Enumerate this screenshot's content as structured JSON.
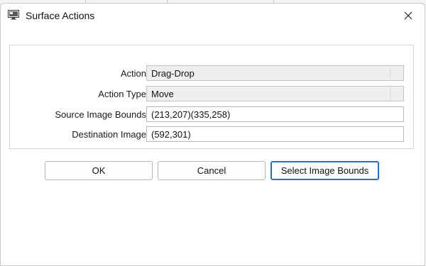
{
  "window": {
    "title": "Surface Actions",
    "icon": "monitor-app-icon",
    "close_icon": "close-icon"
  },
  "form": {
    "action": {
      "label": "Action",
      "value": "Drag-Drop"
    },
    "action_type": {
      "label": "Action Type",
      "value": "Move"
    },
    "source_bounds": {
      "label": "Source Image Bounds",
      "value": "(213,207)(335,258)"
    },
    "destination": {
      "label": "Destination Image",
      "value": "(592,301)"
    }
  },
  "buttons": {
    "ok": "OK",
    "cancel": "Cancel",
    "select_bounds": "Select Image Bounds"
  },
  "colors": {
    "focus_accent": "#1f6fcf",
    "readonly_fill": "#efefef"
  }
}
